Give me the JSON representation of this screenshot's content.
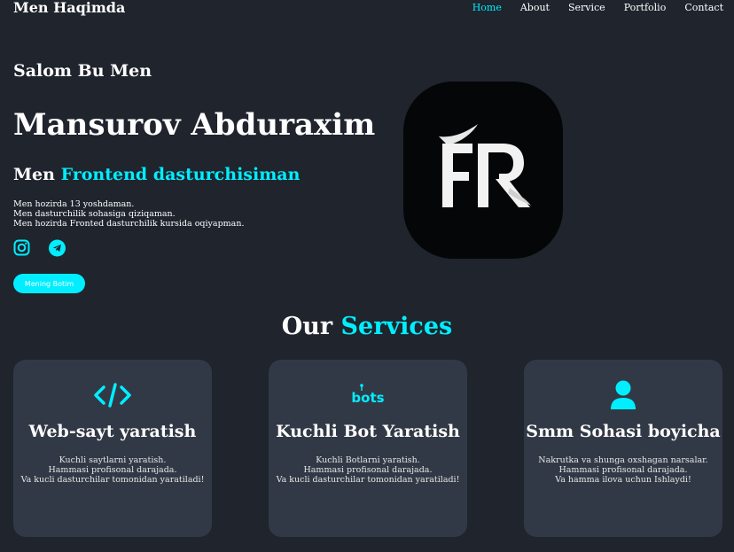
{
  "header": {
    "logo": "Men Haqimda",
    "nav": [
      "Home",
      "About",
      "Service",
      "Portfolio",
      "Contact"
    ]
  },
  "hero": {
    "greeting": "Salom Bu Men",
    "name": "Mansurov Abduraxim",
    "role_prefix": "Men",
    "role_highlight": "Frontend dasturchisiman",
    "bio": [
      "Men hozirda 13 yoshdaman.",
      "Men dasturchilik sohasiga qiziqaman.",
      "Men hozirda Fronted dasturchilik kursida oqiyapman."
    ],
    "socials": [
      "instagram-icon",
      "telegram-icon"
    ],
    "button": "Mening Botim",
    "logo_text": "FR"
  },
  "services": {
    "title_prefix": "Our",
    "title_highlight": "Services",
    "cards": [
      {
        "icon": "code-icon",
        "title": "Web-sayt yaratish",
        "desc": [
          "Kuchli saytlarni yaratish.",
          "Hammasi profisonal darajada.",
          "Va kucli dasturchilar tomonidan yaratiladi!"
        ]
      },
      {
        "icon": "bots-icon",
        "icon_text": "bots",
        "title": "Kuchli Bot Yaratish",
        "desc": [
          "Kuchli Botlarni yaratish.",
          "Hammasi profisonal darajada.",
          "Va kucli dasturchilar tomonidan yaratiladi!"
        ]
      },
      {
        "icon": "user-icon",
        "title": "Smm Sohasi boyicha",
        "desc": [
          "Nakrutka va shunga oxshagan narsalar.",
          "Hammasi profisonal darajada.",
          "Va hamma ilova uchun Ishlaydi!"
        ]
      }
    ]
  },
  "colors": {
    "background": "#1f242d",
    "card": "#323946",
    "accent": "#00eeff",
    "text": "#ffffff"
  }
}
